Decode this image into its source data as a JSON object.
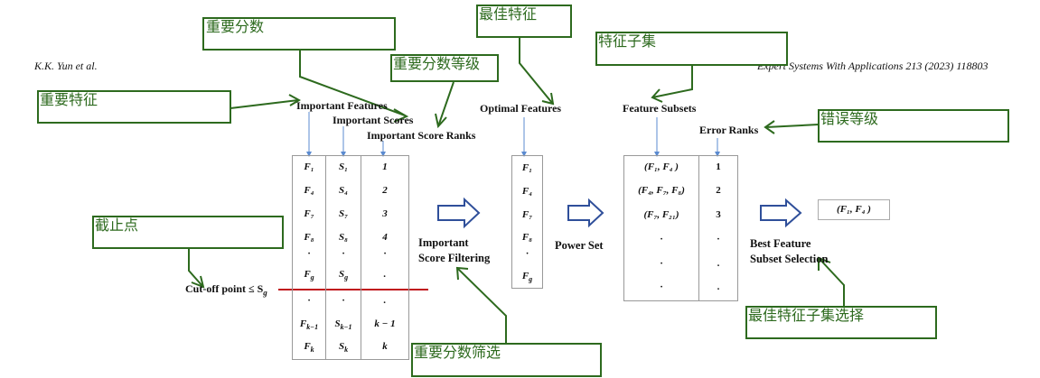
{
  "header": {
    "authors": "K.K. Yun et al.",
    "journal": "Expert Systems With Applications 213 (2023) 118803"
  },
  "annotations": {
    "important_scores": "重要分数",
    "important_score_ranks": "重要分数等级",
    "important_features": "重要特征",
    "optimal_features": "最佳特征",
    "feature_subsets": "特征子集",
    "error_ranks": "错误等级",
    "cutoff_point": "截止点",
    "best_feature_subset_selection": "最佳特征子集选择",
    "important_score_filtering": "重要分数筛选"
  },
  "labels": {
    "important_features": "Important Features",
    "important_scores": "Important Scores",
    "important_score_ranks": "Important Score Ranks",
    "optimal_features": "Optimal Features",
    "feature_subsets": "Feature Subsets",
    "error_ranks": "Error Ranks",
    "cutoff": "Cut-off point ≤ S",
    "cutoff_sub": "g",
    "filtering_line1": "Important",
    "filtering_line2": "Score Filtering",
    "power_set": "Power Set",
    "best_line1": "Best Feature",
    "best_line2": "Subset Selection",
    "result": "(F₁, F₄ )"
  },
  "table": {
    "features": [
      "F₁",
      "F₄",
      "F₇",
      "F₈",
      "·",
      "F_g",
      "·",
      "F_{k−1}",
      "F_k"
    ],
    "scores": [
      "S₁",
      "S₄",
      "S₇",
      "S₈",
      "·",
      "S_g",
      "·",
      "S_{k−1}",
      "S_k"
    ],
    "ranks": [
      "1",
      "2",
      "3",
      "4",
      "·",
      ".",
      ".",
      "k − 1",
      "k"
    ]
  },
  "optimal": [
    "F₁",
    "F₄",
    "F₇",
    "F₈",
    "·",
    "F_g"
  ],
  "subsets": [
    "(F₁, F₄ )",
    "(F₄, F₇, F₈)",
    "(F₇, F₂₁)",
    "·",
    "·",
    "·"
  ],
  "error_ranks": [
    "1",
    "2",
    "3",
    "·",
    ".",
    "."
  ],
  "colors": {
    "annotation": "#2d6a1e",
    "flow_arrow": "#2f4f9a",
    "pointer_arrow": "#5b8bd0",
    "cutoff_line": "#c0141c"
  },
  "icons": {
    "flow": "hollow-right-arrow",
    "pointer": "down-arrow"
  }
}
